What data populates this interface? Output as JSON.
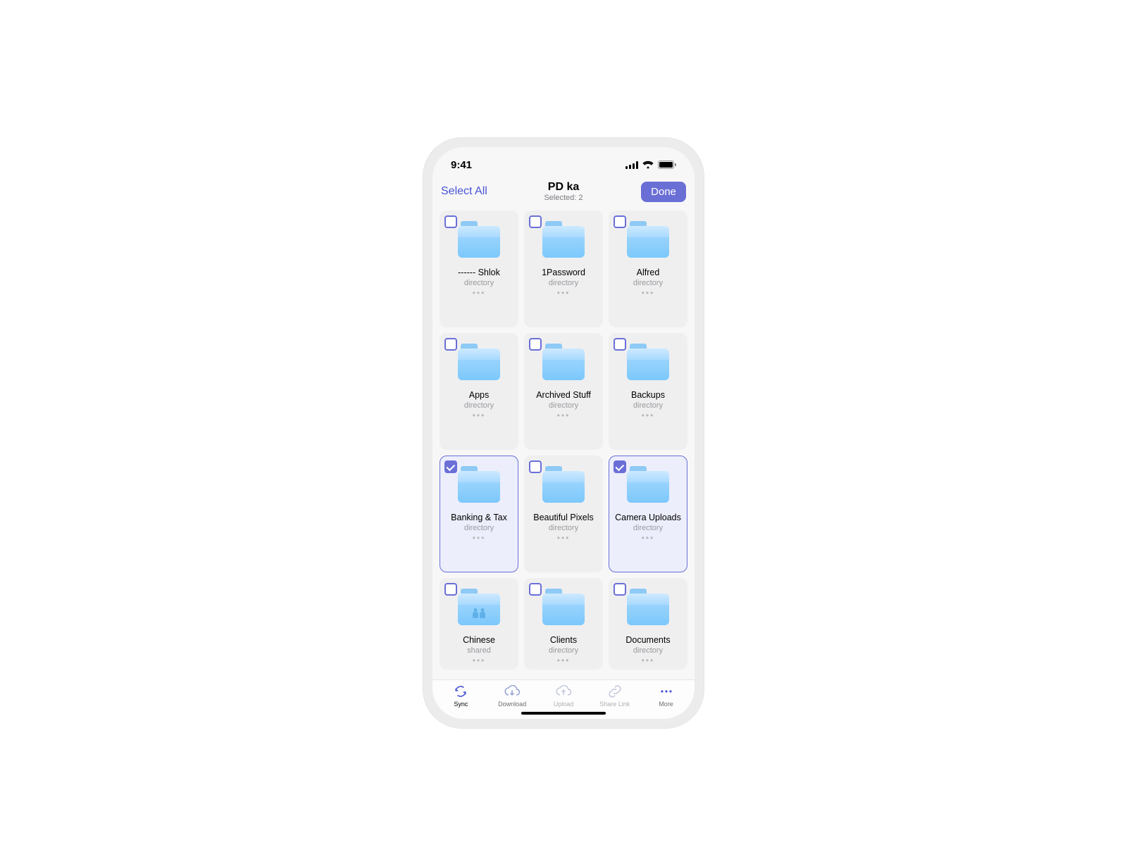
{
  "statusbar": {
    "time": "9:41"
  },
  "header": {
    "select_all": "Select All",
    "title": "PD ka",
    "subtitle": "Selected: 2",
    "done": "Done"
  },
  "folders": [
    {
      "name": "------ Shlok",
      "type": "directory",
      "selected": false,
      "shared": false
    },
    {
      "name": "1Password",
      "type": "directory",
      "selected": false,
      "shared": false
    },
    {
      "name": "Alfred",
      "type": "directory",
      "selected": false,
      "shared": false
    },
    {
      "name": "Apps",
      "type": "directory",
      "selected": false,
      "shared": false
    },
    {
      "name": "Archived Stuff",
      "type": "directory",
      "selected": false,
      "shared": false
    },
    {
      "name": "Backups",
      "type": "directory",
      "selected": false,
      "shared": false
    },
    {
      "name": "Banking & Tax",
      "type": "directory",
      "selected": true,
      "shared": false
    },
    {
      "name": "Beautiful Pixels",
      "type": "directory",
      "selected": false,
      "shared": false
    },
    {
      "name": "Camera Uploads",
      "type": "directory",
      "selected": true,
      "shared": false
    },
    {
      "name": "Chinese",
      "type": "shared",
      "selected": false,
      "shared": true
    },
    {
      "name": "Clients",
      "type": "directory",
      "selected": false,
      "shared": false
    },
    {
      "name": "Documents",
      "type": "directory",
      "selected": false,
      "shared": false
    }
  ],
  "toolbar": {
    "sync": "Sync",
    "download": "Download",
    "upload": "Upload",
    "share": "Share Link",
    "more": "More"
  }
}
